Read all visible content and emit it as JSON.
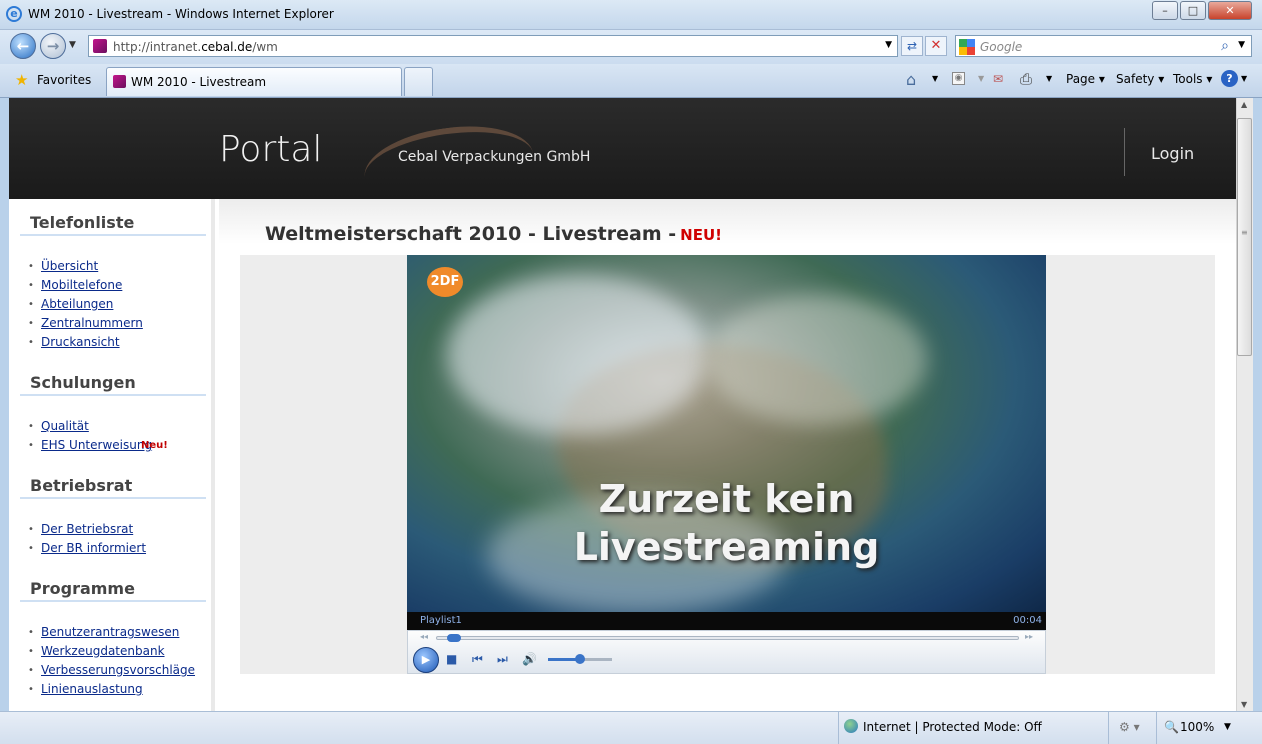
{
  "window": {
    "title": "WM 2010 - Livestream - Windows Internet Explorer"
  },
  "toolbar": {
    "url_prefix": "http://intranet.",
    "url_domain": "cebal.de",
    "url_path": "/wm",
    "search_placeholder": "Google",
    "favorites": "Favorites",
    "tab_title": "WM 2010 - Livestream",
    "page": "Page",
    "safety": "Safety",
    "tools": "Tools"
  },
  "header": {
    "portal": "Portal",
    "company": "Cebal Verpackungen GmbH",
    "login": "Login"
  },
  "sidebar": {
    "sections": [
      {
        "title": "Telefonliste",
        "items": [
          "Übersicht",
          "Mobiltelefone",
          "Abteilungen",
          "Zentralnummern",
          "Druckansicht"
        ]
      },
      {
        "title": "Schulungen",
        "items": [
          "Qualität",
          "EHS Unterweisung"
        ]
      },
      {
        "title": "Betriebsrat",
        "items": [
          "Der Betriebsrat",
          "Der BR informiert"
        ]
      },
      {
        "title": "Programme",
        "items": [
          "Benutzerantragswesen",
          "Werkzeugdatenbank",
          "Verbesserungsvorschläge",
          "Linienauslastung"
        ]
      }
    ],
    "new_badge": "Neu!"
  },
  "main": {
    "headline": "Weltmeisterschaft 2010 - Livestream -",
    "headline_new": "NEU!"
  },
  "player": {
    "logo": "2DF",
    "message_line1": "Zurzeit kein",
    "message_line2": "Livestreaming",
    "playlist": "Playlist1",
    "time": "00:04",
    "seek_fraction": 0.02,
    "volume_fraction": 0.5
  },
  "status": {
    "zone": "Internet | Protected Mode: Off",
    "zoom": "100%"
  }
}
